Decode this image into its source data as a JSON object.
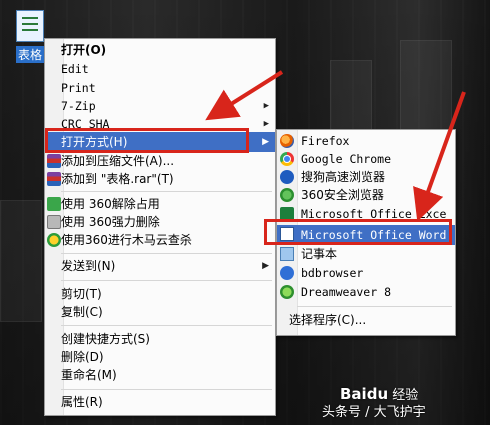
{
  "desktop_icon": {
    "label": "表格",
    "icon": "spreadsheet-file-icon"
  },
  "context_menu": {
    "items": [
      {
        "label": "打开(O)",
        "bold": true
      },
      {
        "label": "Edit"
      },
      {
        "label": "Print"
      },
      {
        "label": "7-Zip",
        "submenu": true
      },
      {
        "label": "CRC SHA",
        "submenu": true
      },
      {
        "label": "打开方式(H)",
        "submenu": true,
        "highlighted": true
      },
      {
        "label": "添加到压缩文件(A)...",
        "icon": "archive-icon"
      },
      {
        "label": "添加到 \"表格.rar\"(T)",
        "icon": "archive-icon"
      },
      {
        "label": "使用 360解除占用",
        "icon": "360-unlock-icon"
      },
      {
        "label": "使用 360强力删除",
        "icon": "360-delete-icon"
      },
      {
        "label": "使用360进行木马云查杀",
        "icon": "360-scan-icon"
      },
      {
        "label": "发送到(N)",
        "submenu": true
      },
      {
        "label": "剪切(T)"
      },
      {
        "label": "复制(C)"
      },
      {
        "label": "创建快捷方式(S)"
      },
      {
        "label": "删除(D)"
      },
      {
        "label": "重命名(M)"
      },
      {
        "label": "属性(R)"
      }
    ]
  },
  "open_with_menu": {
    "items": [
      {
        "label": "Firefox",
        "icon": "firefox-icon"
      },
      {
        "label": "Google Chrome",
        "icon": "chrome-icon"
      },
      {
        "label": "搜狗高速浏览器",
        "icon": "sogou-browser-icon"
      },
      {
        "label": "360安全浏览器",
        "icon": "360-browser-icon"
      },
      {
        "label": "Microsoft Office Exce",
        "icon": "excel-icon"
      },
      {
        "label": "Microsoft Office Word",
        "icon": "word-icon",
        "highlighted": true
      },
      {
        "label": "记事本",
        "icon": "notepad-icon"
      },
      {
        "label": "bdbrowser",
        "icon": "bdbrowser-icon"
      },
      {
        "label": "Dreamweaver 8",
        "icon": "dreamweaver-icon"
      },
      {
        "label": "选择程序(C)..."
      }
    ]
  },
  "watermark": {
    "brand": "Bai",
    "brand2": "经验",
    "paw": "du",
    "line2": "头条号 / 大飞护宇"
  },
  "colors": {
    "highlight": "#3f6fc5",
    "annotation_red": "#d8251b"
  }
}
